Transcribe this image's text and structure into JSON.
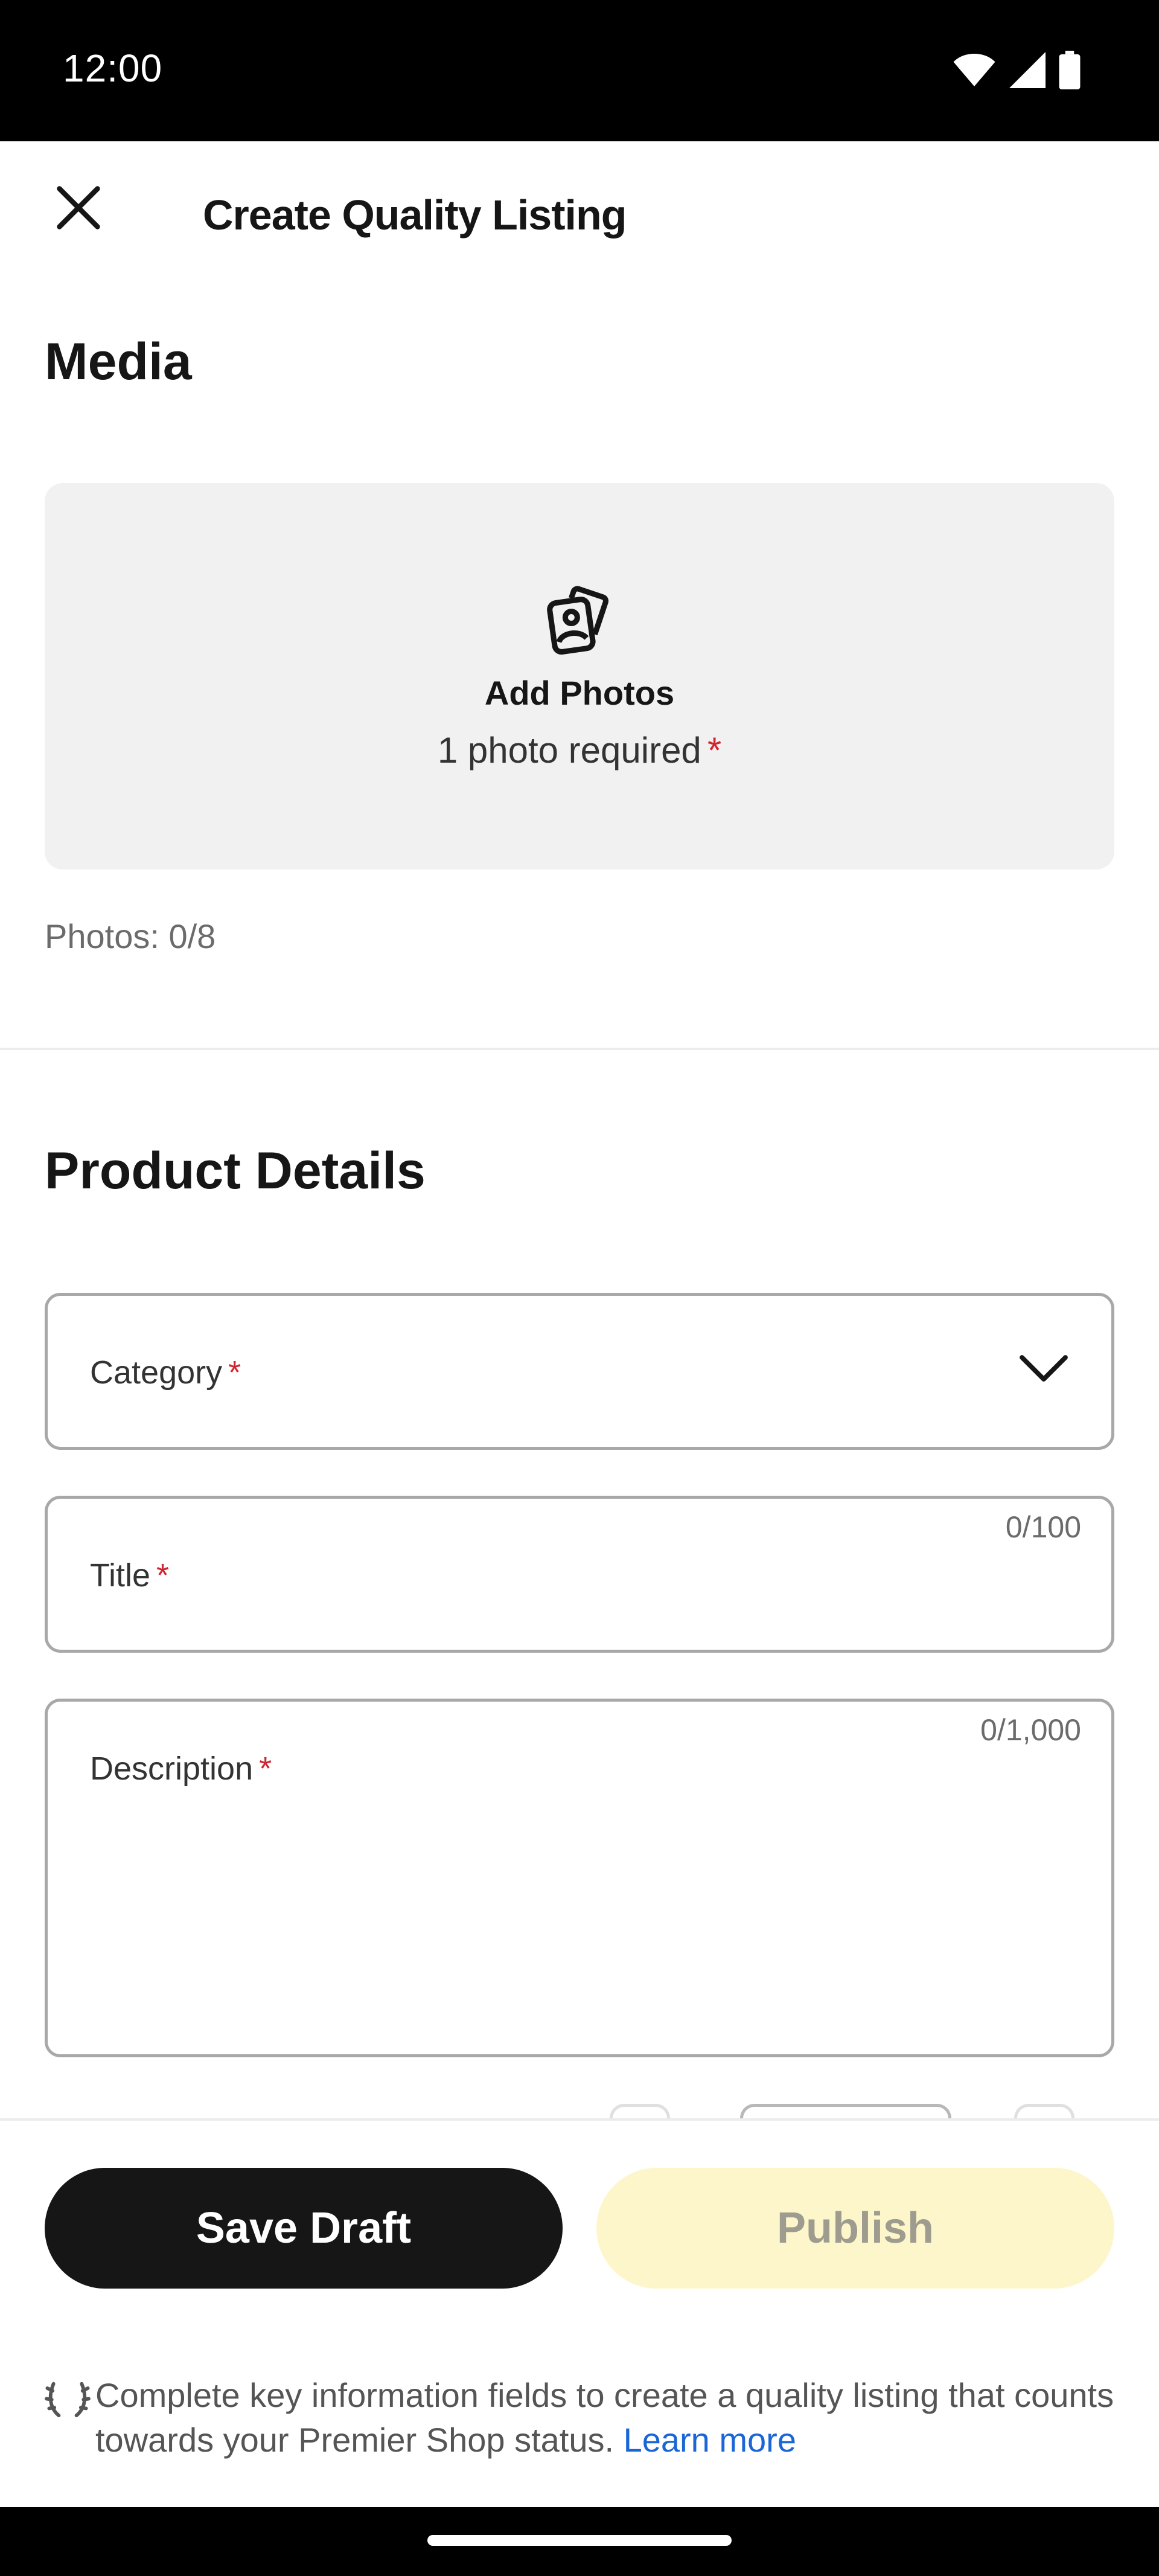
{
  "status_bar": {
    "time": "12:00",
    "icons": [
      "wifi-icon",
      "signal-icon",
      "battery-icon"
    ]
  },
  "header": {
    "title": "Create Quality Listing",
    "close_icon": "close-icon"
  },
  "media": {
    "section_title": "Media",
    "upload": {
      "icon": "photos-icon",
      "title": "Add Photos",
      "subtitle": "1 photo required",
      "required_mark": "*"
    },
    "photos_count": "Photos: 0/8"
  },
  "product_details": {
    "section_title": "Product Details",
    "category": {
      "label": "Category",
      "required_mark": "*",
      "icon": "chevron-down-icon"
    },
    "title": {
      "label": "Title",
      "required_mark": "*",
      "counter": "0/100"
    },
    "description": {
      "label": "Description",
      "required_mark": "*",
      "counter": "0/1,000"
    }
  },
  "actions": {
    "save_draft": "Save Draft",
    "publish": "Publish"
  },
  "notice": {
    "icon": "laurel-icon",
    "text": "Complete key information fields to create a quality listing that counts towards your Premier Shop status. ",
    "link": "Learn more"
  },
  "colors": {
    "required": "#d1242f",
    "link": "#1a66d6",
    "save_button_bg": "#161616",
    "publish_button_bg": "#fdf6cb",
    "upload_box_bg": "#f1f1f1"
  }
}
